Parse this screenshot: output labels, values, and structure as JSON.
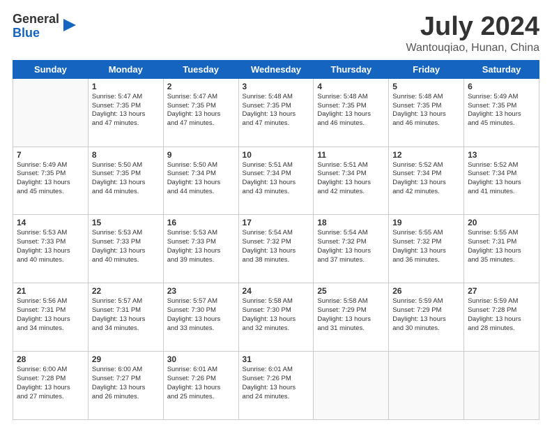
{
  "logo": {
    "line1": "General",
    "line2": "Blue"
  },
  "header": {
    "month": "July 2024",
    "location": "Wantouqiao, Hunan, China"
  },
  "days_of_week": [
    "Sunday",
    "Monday",
    "Tuesday",
    "Wednesday",
    "Thursday",
    "Friday",
    "Saturday"
  ],
  "weeks": [
    [
      {
        "day": "",
        "info": ""
      },
      {
        "day": "1",
        "info": "Sunrise: 5:47 AM\nSunset: 7:35 PM\nDaylight: 13 hours\nand 47 minutes."
      },
      {
        "day": "2",
        "info": "Sunrise: 5:47 AM\nSunset: 7:35 PM\nDaylight: 13 hours\nand 47 minutes."
      },
      {
        "day": "3",
        "info": "Sunrise: 5:48 AM\nSunset: 7:35 PM\nDaylight: 13 hours\nand 47 minutes."
      },
      {
        "day": "4",
        "info": "Sunrise: 5:48 AM\nSunset: 7:35 PM\nDaylight: 13 hours\nand 46 minutes."
      },
      {
        "day": "5",
        "info": "Sunrise: 5:48 AM\nSunset: 7:35 PM\nDaylight: 13 hours\nand 46 minutes."
      },
      {
        "day": "6",
        "info": "Sunrise: 5:49 AM\nSunset: 7:35 PM\nDaylight: 13 hours\nand 45 minutes."
      }
    ],
    [
      {
        "day": "7",
        "info": "Sunrise: 5:49 AM\nSunset: 7:35 PM\nDaylight: 13 hours\nand 45 minutes."
      },
      {
        "day": "8",
        "info": "Sunrise: 5:50 AM\nSunset: 7:35 PM\nDaylight: 13 hours\nand 44 minutes."
      },
      {
        "day": "9",
        "info": "Sunrise: 5:50 AM\nSunset: 7:34 PM\nDaylight: 13 hours\nand 44 minutes."
      },
      {
        "day": "10",
        "info": "Sunrise: 5:51 AM\nSunset: 7:34 PM\nDaylight: 13 hours\nand 43 minutes."
      },
      {
        "day": "11",
        "info": "Sunrise: 5:51 AM\nSunset: 7:34 PM\nDaylight: 13 hours\nand 42 minutes."
      },
      {
        "day": "12",
        "info": "Sunrise: 5:52 AM\nSunset: 7:34 PM\nDaylight: 13 hours\nand 42 minutes."
      },
      {
        "day": "13",
        "info": "Sunrise: 5:52 AM\nSunset: 7:34 PM\nDaylight: 13 hours\nand 41 minutes."
      }
    ],
    [
      {
        "day": "14",
        "info": "Sunrise: 5:53 AM\nSunset: 7:33 PM\nDaylight: 13 hours\nand 40 minutes."
      },
      {
        "day": "15",
        "info": "Sunrise: 5:53 AM\nSunset: 7:33 PM\nDaylight: 13 hours\nand 40 minutes."
      },
      {
        "day": "16",
        "info": "Sunrise: 5:53 AM\nSunset: 7:33 PM\nDaylight: 13 hours\nand 39 minutes."
      },
      {
        "day": "17",
        "info": "Sunrise: 5:54 AM\nSunset: 7:32 PM\nDaylight: 13 hours\nand 38 minutes."
      },
      {
        "day": "18",
        "info": "Sunrise: 5:54 AM\nSunset: 7:32 PM\nDaylight: 13 hours\nand 37 minutes."
      },
      {
        "day": "19",
        "info": "Sunrise: 5:55 AM\nSunset: 7:32 PM\nDaylight: 13 hours\nand 36 minutes."
      },
      {
        "day": "20",
        "info": "Sunrise: 5:55 AM\nSunset: 7:31 PM\nDaylight: 13 hours\nand 35 minutes."
      }
    ],
    [
      {
        "day": "21",
        "info": "Sunrise: 5:56 AM\nSunset: 7:31 PM\nDaylight: 13 hours\nand 34 minutes."
      },
      {
        "day": "22",
        "info": "Sunrise: 5:57 AM\nSunset: 7:31 PM\nDaylight: 13 hours\nand 34 minutes."
      },
      {
        "day": "23",
        "info": "Sunrise: 5:57 AM\nSunset: 7:30 PM\nDaylight: 13 hours\nand 33 minutes."
      },
      {
        "day": "24",
        "info": "Sunrise: 5:58 AM\nSunset: 7:30 PM\nDaylight: 13 hours\nand 32 minutes."
      },
      {
        "day": "25",
        "info": "Sunrise: 5:58 AM\nSunset: 7:29 PM\nDaylight: 13 hours\nand 31 minutes."
      },
      {
        "day": "26",
        "info": "Sunrise: 5:59 AM\nSunset: 7:29 PM\nDaylight: 13 hours\nand 30 minutes."
      },
      {
        "day": "27",
        "info": "Sunrise: 5:59 AM\nSunset: 7:28 PM\nDaylight: 13 hours\nand 28 minutes."
      }
    ],
    [
      {
        "day": "28",
        "info": "Sunrise: 6:00 AM\nSunset: 7:28 PM\nDaylight: 13 hours\nand 27 minutes."
      },
      {
        "day": "29",
        "info": "Sunrise: 6:00 AM\nSunset: 7:27 PM\nDaylight: 13 hours\nand 26 minutes."
      },
      {
        "day": "30",
        "info": "Sunrise: 6:01 AM\nSunset: 7:26 PM\nDaylight: 13 hours\nand 25 minutes."
      },
      {
        "day": "31",
        "info": "Sunrise: 6:01 AM\nSunset: 7:26 PM\nDaylight: 13 hours\nand 24 minutes."
      },
      {
        "day": "",
        "info": ""
      },
      {
        "day": "",
        "info": ""
      },
      {
        "day": "",
        "info": ""
      }
    ]
  ]
}
